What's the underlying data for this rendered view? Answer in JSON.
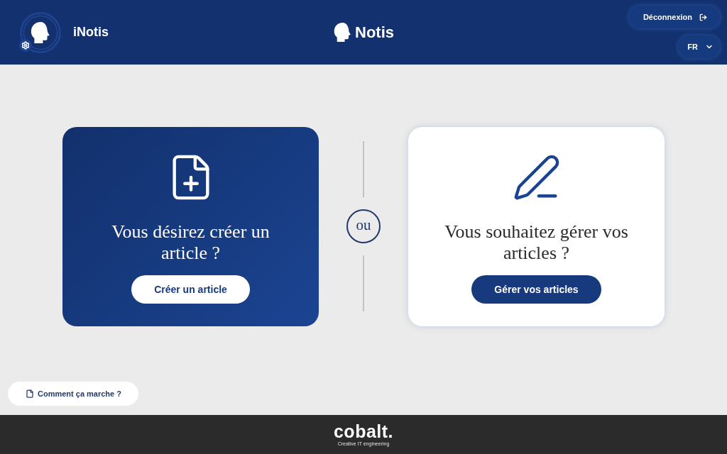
{
  "header": {
    "app_name": "iNotis",
    "brand": "Notis",
    "logout_button": {
      "label": "Déconnexion"
    },
    "language_select": {
      "value": "FR"
    }
  },
  "cards": [
    {
      "kind": "create",
      "title": "Vous désirez créer un article ?",
      "button": "Créer un article"
    },
    {
      "kind": "manage",
      "title": "Vous souhaitez gérer vos articles ?",
      "button": "Gérer vos articles"
    }
  ],
  "separator": {
    "label": "ou"
  },
  "help_button": {
    "label": "Comment ça marche ?"
  },
  "footer": {
    "logo": "cobalt.",
    "tagline": "Creative IT engineering"
  }
}
